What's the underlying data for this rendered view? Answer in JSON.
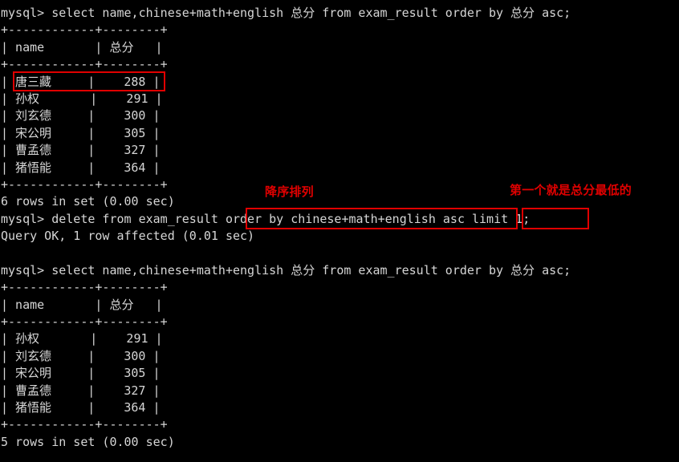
{
  "terminal": {
    "prompt": "mysql> ",
    "background_color": "#000000",
    "text_color": "#d6d6d6",
    "annotation_color": "#e00000",
    "lines": [
      "mysql> select name,chinese+math+english 总分 from exam_result order by 总分 asc;",
      "+------------+--------+",
      "| name       | 总分   |",
      "+------------+--------+",
      "| 唐三藏     |    288 |",
      "| 孙权       |    291 |",
      "| 刘玄德     |    300 |",
      "| 宋公明     |    305 |",
      "| 曹孟德     |    327 |",
      "| 猪悟能     |    364 |",
      "+------------+--------+",
      "6 rows in set (0.00 sec)",
      "mysql> delete from exam_result order by chinese+math+english asc limit 1;",
      "Query OK, 1 row affected (0.01 sec)",
      "",
      "mysql> select name,chinese+math+english 总分 from exam_result order by 总分 asc;",
      "+------------+--------+",
      "| name       | 总分   |",
      "+------------+--------+",
      "| 孙权       |    291 |",
      "| 刘玄德     |    300 |",
      "| 宋公明     |    305 |",
      "| 曹孟德     |    327 |",
      "| 猪悟能     |    364 |",
      "+------------+--------+",
      "5 rows in set (0.00 sec)"
    ]
  },
  "queries": {
    "first_select": "select name,chinese+math+english 总分 from exam_result order by 总分 asc;",
    "delete_stmt": "delete from exam_result order by chinese+math+english asc limit 1;",
    "second_select": "select name,chinese+math+english 总分 from exam_result order by 总分 asc;",
    "delete_result": "Query OK, 1 row affected (0.01 sec)",
    "first_count": "6 rows in set (0.00 sec)",
    "second_count": "5 rows in set (0.00 sec)"
  },
  "annotations": [
    {
      "text": "降序排列",
      "name": "annotation-order-desc"
    },
    {
      "text": "第一个就是总分最低的",
      "name": "annotation-lowest-total"
    }
  ],
  "table_before": {
    "columns": [
      "name",
      "总分"
    ],
    "rows": [
      {
        "name": "唐三藏",
        "total": "288"
      },
      {
        "name": "孙权",
        "total": "291"
      },
      {
        "name": "刘玄德",
        "total": "300"
      },
      {
        "name": "宋公明",
        "total": "305"
      },
      {
        "name": "曹孟德",
        "total": "327"
      },
      {
        "name": "猪悟能",
        "total": "364"
      }
    ],
    "row_count_text": "6 rows in set (0.00 sec)",
    "highlighted_row": "唐三藏"
  },
  "table_after": {
    "columns": [
      "name",
      "总分"
    ],
    "rows": [
      {
        "name": "孙权",
        "total": "291"
      },
      {
        "name": "刘玄德",
        "total": "300"
      },
      {
        "name": "宋公明",
        "total": "305"
      },
      {
        "name": "曹孟德",
        "total": "327"
      },
      {
        "name": "猪悟能",
        "total": "364"
      }
    ],
    "row_count_text": "5 rows in set (0.00 sec)"
  },
  "highlight_boxes": [
    {
      "name": "highlight-box-first-row",
      "label": "| 唐三藏     |    288 |"
    },
    {
      "name": "highlight-box-order-by-clause",
      "label": "order by chinese+math+english asc"
    },
    {
      "name": "highlight-box-limit-clause",
      "label": "limit 1;"
    }
  ]
}
